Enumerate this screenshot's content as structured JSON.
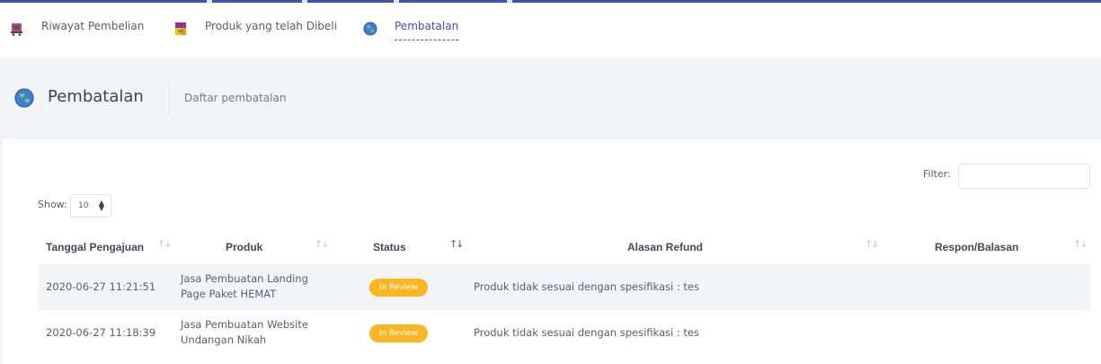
{
  "tabs": [
    {
      "label": "Riwayat Pembelian",
      "icon": "shopping-cart-icon",
      "active": false
    },
    {
      "label": "Produk yang telah Dibeli",
      "icon": "product-box-icon",
      "active": false
    },
    {
      "label": "Pembatalan",
      "icon": "globe-cancel-icon",
      "active": true
    }
  ],
  "subheader": {
    "title": "Pembatalan",
    "description": "Daftar pembatalan",
    "icon": "globe-cancel-icon"
  },
  "filter": {
    "label": "Filter:",
    "value": ""
  },
  "show": {
    "label": "Show:",
    "selected": "10"
  },
  "table": {
    "columns": [
      "Tanggal Pengajuan",
      "Produk",
      "Status",
      "Alasan Refund",
      "Respon/Balasan"
    ],
    "rows": [
      {
        "date": "2020-06-27 11:21:51",
        "product_line1": "Jasa Pembuatan Landing",
        "product_line2": "Page Paket HEMAT",
        "status": "In Review",
        "reason": "Produk tidak sesuai dengan spesifikasi : tes",
        "response": ""
      },
      {
        "date": "2020-06-27 11:18:39",
        "product_line1": "Jasa Pembuatan Website",
        "product_line2": "Undangan Nikah",
        "status": "In Review",
        "reason": "Produk tidak sesuai dengan spesifikasi : tes",
        "response": ""
      }
    ]
  },
  "colors": {
    "accent": "#3f51b5",
    "status_badge": "#fcb61f",
    "row_stripe": "#f3f4f8"
  }
}
